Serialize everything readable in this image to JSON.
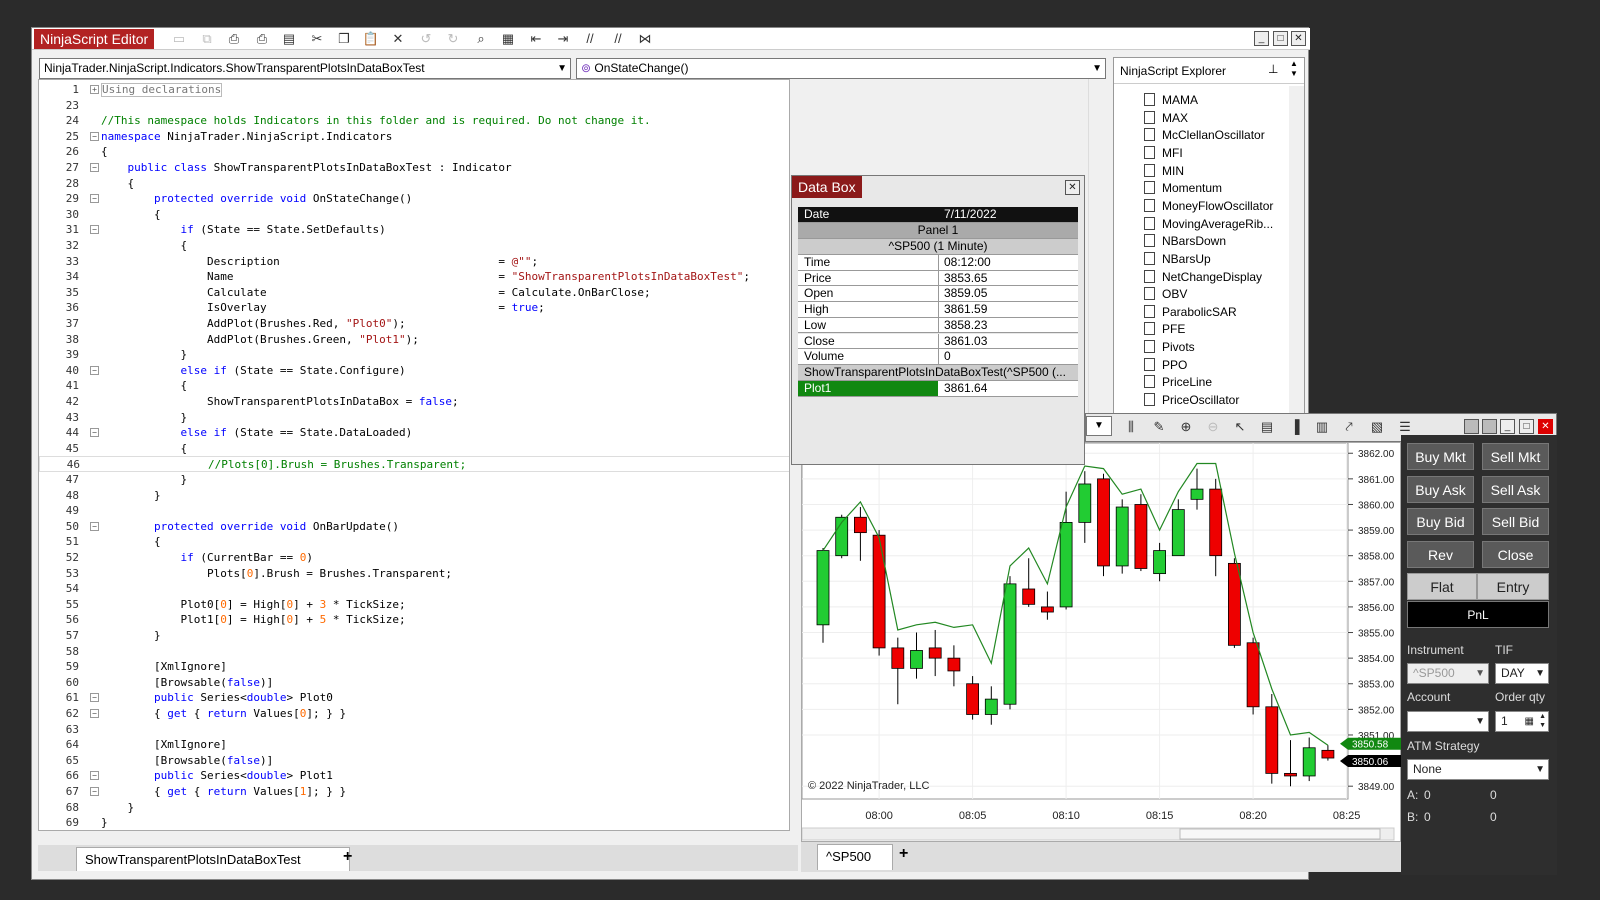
{
  "editor": {
    "title": "NinjaScript Editor",
    "class_dropdown": "NinjaTrader.NinjaScript.Indicators.ShowTransparentPlotsInDataBoxTest",
    "method_dropdown": "OnStateChange()",
    "tab_label": "ShowTransparentPlotsInDataBoxTest",
    "add_tab": "+",
    "lines": [
      {
        "n": "1",
        "fold": "+",
        "text": "Using declarations",
        "cls": "box"
      },
      {
        "n": "23",
        "text": ""
      },
      {
        "n": "24",
        "text": "//This namespace holds Indicators in this folder and is required. Do not change it.",
        "cls": "cm"
      },
      {
        "n": "25",
        "fold": "-",
        "html": "<span class='kw'>namespace</span> NinjaTrader.NinjaScript.Indicators"
      },
      {
        "n": "26",
        "text": "{"
      },
      {
        "n": "27",
        "fold": "-",
        "html": "    <span class='kw'>public class</span> ShowTransparentPlotsInDataBoxTest : Indicator"
      },
      {
        "n": "28",
        "text": "    {"
      },
      {
        "n": "29",
        "fold": "-",
        "html": "        <span class='kw'>protected override void</span> OnStateChange()"
      },
      {
        "n": "30",
        "text": "        {"
      },
      {
        "n": "31",
        "fold": "-",
        "html": "            <span class='kw'>if</span> (State == State.SetDefaults)"
      },
      {
        "n": "32",
        "text": "            {"
      },
      {
        "n": "33",
        "html": "                Description                                 = <span class='st'>@\"\"</span>;"
      },
      {
        "n": "34",
        "html": "                Name                                        = <span class='st'>\"ShowTransparentPlotsInDataBoxTest\"</span>;"
      },
      {
        "n": "35",
        "text": "                Calculate                                   = Calculate.OnBarClose;"
      },
      {
        "n": "36",
        "html": "                IsOverlay                                   = <span class='kw'>true</span>;"
      },
      {
        "n": "37",
        "html": "                AddPlot(Brushes.Red, <span class='st'>\"Plot0\"</span>);"
      },
      {
        "n": "38",
        "html": "                AddPlot(Brushes.Green, <span class='st'>\"Plot1\"</span>);"
      },
      {
        "n": "39",
        "text": "            }"
      },
      {
        "n": "40",
        "fold": "-",
        "html": "            <span class='kw'>else if</span> (State == State.Configure)"
      },
      {
        "n": "41",
        "text": "            {"
      },
      {
        "n": "42",
        "html": "                ShowTransparentPlotsInDataBox = <span class='kw'>false</span>;"
      },
      {
        "n": "43",
        "text": "            }"
      },
      {
        "n": "44",
        "fold": "-",
        "html": "            <span class='kw'>else if</span> (State == State.DataLoaded)"
      },
      {
        "n": "45",
        "text": "            {"
      },
      {
        "n": "46",
        "html": "                <span class='cm'>//Plots[0].Brush = Brushes.Transparent;</span>"
      },
      {
        "n": "47",
        "text": "            }"
      },
      {
        "n": "48",
        "text": "        }"
      },
      {
        "n": "49",
        "text": ""
      },
      {
        "n": "50",
        "fold": "-",
        "html": "        <span class='kw'>protected override void</span> OnBarUpdate()"
      },
      {
        "n": "51",
        "text": "        {"
      },
      {
        "n": "52",
        "html": "            <span class='kw'>if</span> (CurrentBar == <span class='nm'>0</span>)"
      },
      {
        "n": "53",
        "html": "                Plots[<span class='nm'>0</span>].Brush = Brushes.Transparent;"
      },
      {
        "n": "54",
        "text": ""
      },
      {
        "n": "55",
        "html": "            Plot0[<span class='nm'>0</span>] = High[<span class='nm'>0</span>] + <span class='nm'>3</span> * TickSize;"
      },
      {
        "n": "56",
        "html": "            Plot1[<span class='nm'>0</span>] = High[<span class='nm'>0</span>] + <span class='nm'>5</span> * TickSize;"
      },
      {
        "n": "57",
        "text": "        }"
      },
      {
        "n": "58",
        "text": ""
      },
      {
        "n": "59",
        "text": "        [XmlIgnore]"
      },
      {
        "n": "60",
        "html": "        [Browsable(<span class='kw'>false</span>)]"
      },
      {
        "n": "61",
        "fold": "-",
        "html": "        <span class='kw'>public</span> Series&lt;<span class='kw'>double</span>&gt; Plot0"
      },
      {
        "n": "62",
        "fold": "-",
        "html": "        { <span class='kw'>get</span> { <span class='kw'>return</span> Values[<span class='nm'>0</span>]; } }"
      },
      {
        "n": "63",
        "text": ""
      },
      {
        "n": "64",
        "text": "        [XmlIgnore]"
      },
      {
        "n": "65",
        "html": "        [Browsable(<span class='kw'>false</span>)]"
      },
      {
        "n": "66",
        "fold": "-",
        "html": "        <span class='kw'>public</span> Series&lt;<span class='kw'>double</span>&gt; Plot1"
      },
      {
        "n": "67",
        "fold": "-",
        "html": "        { <span class='kw'>get</span> { <span class='kw'>return</span> Values[<span class='nm'>1</span>]; } }"
      },
      {
        "n": "68",
        "text": "    }"
      },
      {
        "n": "69",
        "text": "}"
      }
    ]
  },
  "explorer": {
    "title": "NinjaScript Explorer",
    "items": [
      "MAMA",
      "MAX",
      "McClellanOscillator",
      "MFI",
      "MIN",
      "Momentum",
      "MoneyFlowOscillator",
      "MovingAverageRib...",
      "NBarsDown",
      "NBarsUp",
      "NetChangeDisplay",
      "OBV",
      "ParabolicSAR",
      "PFE",
      "Pivots",
      "PPO",
      "PriceLine",
      "PriceOscillator"
    ]
  },
  "databox": {
    "title": "Data Box",
    "date_label": "Date",
    "date_value": "7/11/2022",
    "panel": "Panel 1",
    "series_header": "^SP500 (1 Minute)",
    "rows": [
      {
        "k": "Time",
        "v": "08:12:00"
      },
      {
        "k": "Price",
        "v": "3853.65"
      },
      {
        "k": "Open",
        "v": "3859.05"
      },
      {
        "k": "High",
        "v": "3861.59"
      },
      {
        "k": "Low",
        "v": "3858.23"
      },
      {
        "k": "Close",
        "v": "3861.03"
      },
      {
        "k": "Volume",
        "v": "0"
      }
    ],
    "indicator_header": "ShowTransparentPlotsInDataBoxTest(^SP500 (...",
    "plot_label": "Plot1",
    "plot_value": "3861.64"
  },
  "chart": {
    "copyright": "© 2022 NinjaTrader, LLC",
    "tab": "^SP500",
    "add_tab": "+",
    "price_tag_plot": "3850.58",
    "price_tag_last": "3850.06",
    "colors": {
      "up": "#22cc33",
      "down": "#ee0000",
      "line": "#228822"
    }
  },
  "chart_data": {
    "type": "candlestick",
    "y_ticks": [
      "3862.00",
      "3861.00",
      "3860.00",
      "3859.00",
      "3858.00",
      "3857.00",
      "3856.00",
      "3855.00",
      "3854.00",
      "3853.00",
      "3852.00",
      "3851.00",
      "3849.00"
    ],
    "x_ticks": [
      "08:00",
      "08:05",
      "08:10",
      "08:15",
      "08:20",
      "08:25"
    ],
    "ylim": [
      3848.5,
      3862.4
    ],
    "candles": [
      {
        "o": 3855.3,
        "c": 3858.2,
        "h": 3858.3,
        "l": 3854.6
      },
      {
        "o": 3858.0,
        "c": 3859.5,
        "h": 3859.6,
        "l": 3857.9
      },
      {
        "o": 3859.5,
        "c": 3858.9,
        "h": 3859.9,
        "l": 3857.8
      },
      {
        "o": 3858.8,
        "c": 3854.4,
        "h": 3859.0,
        "l": 3854.1
      },
      {
        "o": 3854.4,
        "c": 3853.6,
        "h": 3854.8,
        "l": 3852.2
      },
      {
        "o": 3853.6,
        "c": 3854.3,
        "h": 3855.0,
        "l": 3853.2
      },
      {
        "o": 3854.4,
        "c": 3854.0,
        "h": 3855.1,
        "l": 3853.3
      },
      {
        "o": 3854.0,
        "c": 3853.5,
        "h": 3854.5,
        "l": 3852.9
      },
      {
        "o": 3853.0,
        "c": 3851.8,
        "h": 3853.3,
        "l": 3851.6
      },
      {
        "o": 3851.8,
        "c": 3852.4,
        "h": 3852.9,
        "l": 3851.4
      },
      {
        "o": 3852.2,
        "c": 3856.9,
        "h": 3857.2,
        "l": 3852.0
      },
      {
        "o": 3856.7,
        "c": 3856.1,
        "h": 3857.9,
        "l": 3856.0
      },
      {
        "o": 3856.0,
        "c": 3855.8,
        "h": 3856.6,
        "l": 3855.5
      },
      {
        "o": 3856.0,
        "c": 3859.3,
        "h": 3860.5,
        "l": 3855.9
      },
      {
        "o": 3859.3,
        "c": 3860.8,
        "h": 3861.3,
        "l": 3858.5
      },
      {
        "o": 3861.0,
        "c": 3857.6,
        "h": 3861.2,
        "l": 3857.2
      },
      {
        "o": 3857.6,
        "c": 3859.9,
        "h": 3860.2,
        "l": 3857.3
      },
      {
        "o": 3860.0,
        "c": 3857.5,
        "h": 3860.4,
        "l": 3857.4
      },
      {
        "o": 3857.3,
        "c": 3858.2,
        "h": 3858.5,
        "l": 3857.0
      },
      {
        "o": 3858.0,
        "c": 3859.8,
        "h": 3860.2,
        "l": 3858.0
      },
      {
        "o": 3860.2,
        "c": 3860.6,
        "h": 3861.4,
        "l": 3859.8
      },
      {
        "o": 3860.6,
        "c": 3858.0,
        "h": 3861.0,
        "l": 3857.2
      },
      {
        "o": 3857.7,
        "c": 3854.5,
        "h": 3857.9,
        "l": 3854.4
      },
      {
        "o": 3854.6,
        "c": 3852.1,
        "h": 3854.8,
        "l": 3851.8
      },
      {
        "o": 3852.1,
        "c": 3849.5,
        "h": 3852.6,
        "l": 3849.1
      },
      {
        "o": 3849.5,
        "c": 3849.4,
        "h": 3850.8,
        "l": 3849.0
      },
      {
        "o": 3849.4,
        "c": 3850.5,
        "h": 3850.9,
        "l": 3849.2
      },
      {
        "o": 3850.4,
        "c": 3850.1,
        "h": 3850.6,
        "l": 3850.0
      }
    ],
    "plot1": [
      3858.2,
      3859.3,
      3860.1,
      3858.7,
      3855.1,
      3855.3,
      3855.4,
      3855.2,
      3855.3,
      3853.8,
      3857.6,
      3858.3,
      3856.9,
      3859.9,
      3861.5,
      3861.4,
      3860.4,
      3860.6,
      3859.0,
      3860.5,
      3861.6,
      3861.6,
      3858.1,
      3855.0,
      3852.8,
      3851.0,
      3851.1,
      3850.6
    ]
  },
  "trade": {
    "buttons": [
      [
        "Buy Mkt",
        "Sell Mkt"
      ],
      [
        "Buy Ask",
        "Sell Ask"
      ],
      [
        "Buy Bid",
        "Sell Bid"
      ],
      [
        "Rev",
        "Close"
      ]
    ],
    "flat": "Flat",
    "entry": "Entry",
    "pnl": "PnL",
    "instrument_label": "Instrument",
    "instrument": "^SP500",
    "tif_label": "TIF",
    "tif": "DAY",
    "account_label": "Account",
    "account": "",
    "qty_label": "Order qty",
    "qty": "1",
    "atm_label": "ATM Strategy",
    "atm": "None",
    "a_label": "A:",
    "a1": "0",
    "a2": "0",
    "b_label": "B:",
    "b1": "0",
    "b2": "0"
  }
}
